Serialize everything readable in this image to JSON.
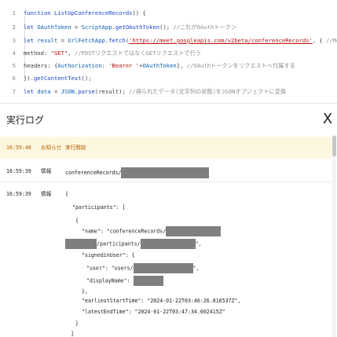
{
  "editor": {
    "lines": [
      {
        "num": "1",
        "parts": [
          {
            "c": "kw",
            "t": "function "
          },
          {
            "c": "fn",
            "t": "ListUpConferenceRecords"
          },
          {
            "c": "pl",
            "t": "() {"
          }
        ]
      },
      {
        "num": "2",
        "parts": [
          {
            "c": "kw",
            "t": "  let "
          },
          {
            "c": "vr",
            "t": "OAuthToken"
          },
          {
            "c": "pl",
            "t": " = "
          },
          {
            "c": "vr",
            "t": "ScriptApp"
          },
          {
            "c": "pl",
            "t": "."
          },
          {
            "c": "fn",
            "t": "getOAuthToken"
          },
          {
            "c": "pl",
            "t": "(); "
          },
          {
            "c": "cm",
            "t": "//これがOAuthトークン"
          }
        ]
      },
      {
        "num": "3",
        "parts": [
          {
            "c": "kw",
            "t": "  let "
          },
          {
            "c": "vr",
            "t": "result"
          },
          {
            "c": "pl",
            "t": " = "
          },
          {
            "c": "vr",
            "t": "UrlFetchApp"
          },
          {
            "c": "pl",
            "t": "."
          },
          {
            "c": "fn",
            "t": "fetch"
          },
          {
            "c": "pl",
            "t": "("
          },
          {
            "c": "url",
            "t": "'https://meet.googleapis.com/v2beta/conferenceRecords'"
          },
          {
            "c": "pl",
            "t": ", { "
          },
          {
            "c": "cm",
            "t": "//Meet APIへリクエスト"
          }
        ]
      },
      {
        "num": "4",
        "parts": [
          {
            "c": "pl",
            "t": "    method: "
          },
          {
            "c": "str",
            "t": "\"GET\""
          },
          {
            "c": "pl",
            "t": ", "
          },
          {
            "c": "cm",
            "t": "//POSTリクエストではなくGETリクエストで行う"
          }
        ]
      },
      {
        "num": "5",
        "parts": [
          {
            "c": "pl",
            "t": "    headers: {"
          },
          {
            "c": "vr",
            "t": "Authorization"
          },
          {
            "c": "pl",
            "t": ": "
          },
          {
            "c": "str",
            "t": "'Bearer '"
          },
          {
            "c": "pl",
            "t": "+"
          },
          {
            "c": "vr",
            "t": "OAuthToken"
          },
          {
            "c": "pl",
            "t": "}, "
          },
          {
            "c": "cm",
            "t": "//OAuthトークンをリクエストヘ付属する"
          }
        ]
      },
      {
        "num": "6",
        "parts": [
          {
            "c": "pl",
            "t": "  })."
          },
          {
            "c": "fn",
            "t": "getContentText"
          },
          {
            "c": "pl",
            "t": "();"
          }
        ]
      },
      {
        "num": "7",
        "parts": [
          {
            "c": "kw",
            "t": "  let "
          },
          {
            "c": "vr",
            "t": "data"
          },
          {
            "c": "pl",
            "t": " = "
          },
          {
            "c": "vr",
            "t": "JSON"
          },
          {
            "c": "pl",
            "t": "."
          },
          {
            "c": "fn",
            "t": "parse"
          },
          {
            "c": "pl",
            "t": "(result); "
          },
          {
            "c": "cm",
            "t": "//得られたデータ(文字列の状態)をJSONオブジェクトに変換"
          }
        ]
      }
    ]
  },
  "log": {
    "title": "実行ログ",
    "close_label": "X",
    "rows": [
      {
        "time": "16:59:48",
        "level": "お知らせ",
        "message": "実行開始"
      },
      {
        "time": "16:59:39",
        "level": "情報",
        "message": "conferenceRecords/"
      },
      {
        "time": "16:59:39",
        "level": "情報",
        "message": "{"
      }
    ],
    "json_lines": {
      "participants_key": "\"participants\": [",
      "open_brace": "{",
      "name_key": "\"name\": \"conferenceRecords/",
      "participants_path": "/participants/",
      "participants_end": "\",",
      "signedin_key": "\"signedinUser\": {",
      "user_key": "\"user\": \"users/",
      "user_end": "\",",
      "display_key": "\"displayName\":",
      "close_brace_comma": "},",
      "earliest": "\"earliestStartTime\": \"2024-01-22T03:46:26.816537Z\",",
      "latest": "\"latestEndTime\": \"2024-01-22T03:47:34.602415Z\"",
      "close_brace": "}",
      "close_bracket": "]"
    }
  },
  "colors": {
    "keyword": "#1a47c8",
    "string": "#b31412",
    "comment": "#8a8f94",
    "warning_bg": "#fef7e0",
    "warning_text": "#b06000",
    "redaction": "#7f7f7f"
  }
}
